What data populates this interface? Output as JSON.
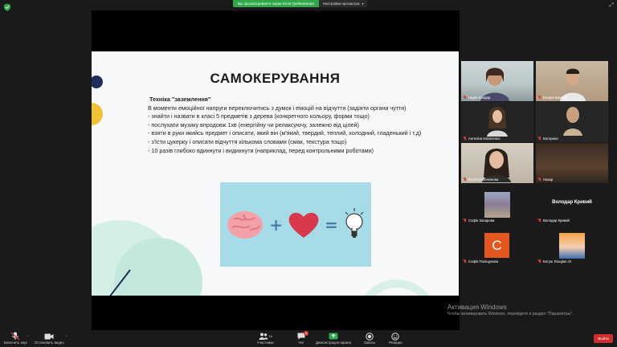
{
  "top_bar": {
    "share_label": "Вы просматриваете экран Юлія Гребеннікова",
    "view_options_label": "Настройки просмотра"
  },
  "slide": {
    "title": "САМОКЕРУВАННЯ",
    "heading": "Техніка \"заземлення\"",
    "lines": [
      "В моменти емоційної напруги переключитись з думок і емоцій на відчуття (задіяти органи чуття)",
      "- знайти і назвати в класі 5 предметів з дерева (конкретного кольору, форми тощо)",
      "- послухати музику впродовж 1хв (енергійну чи релаксуючу, залежно від цілей)",
      "- взяти в  руки якийсь предмет і описати, який він (м'який, твердий, теплий, холодний, гладенький і т.д)",
      "- з'їсти цукерку і описати відчуття кількома словами (смак, текстура тощо)",
      "- 10 разів глибоко вдихнути і видихнути (наприклад, перед контрольними роботами)"
    ]
  },
  "participants": [
    {
      "name": "Надія Бондар"
    },
    {
      "name": "Богдан Шевчук"
    },
    {
      "name": "Ангеліна Коваленко"
    },
    {
      "name": "Катерина"
    },
    {
      "name": "Юлія Гребеннікова"
    },
    {
      "name": "Назар"
    },
    {
      "name": "Софія Захарова"
    },
    {
      "name": "Володар Кривий",
      "center": "Володар Кривий"
    },
    {
      "name": "Софія Поліщукова",
      "initial": "С"
    },
    {
      "name": "Богуш Douglas ch"
    }
  ],
  "watermark": {
    "title": "Активация Windows",
    "subtitle": "Чтобы активировать Windows, перейдите в раздел \"Параметры\"."
  },
  "toolbar": {
    "mute": "Включить звук",
    "stop_video": "Остановить видео",
    "participants": "Участники",
    "participants_count": "10",
    "chat": "Чат",
    "chat_badge": "1",
    "share": "Демонстрация экрана",
    "record": "Запись",
    "reactions": "Реакции",
    "end": "Выйти"
  }
}
